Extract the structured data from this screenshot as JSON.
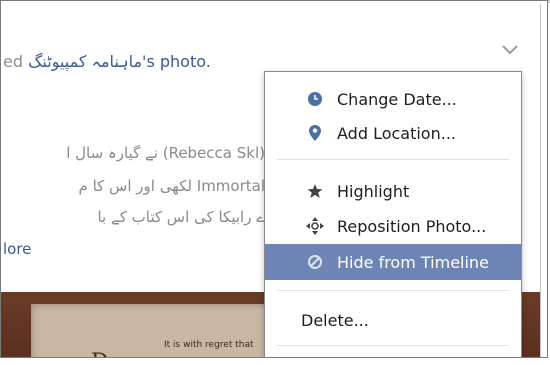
{
  "post": {
    "header_prefix": "ed ",
    "page_name": "ماہنامہ کمپیوٹنگ",
    "header_tail": "'s photo.",
    "body_lines": [
      "(Rebecca Skl) نے گیارہ سال ا",
      "Immortal لکھی اور اس کا م",
      "ے رابیکا کی اس کتاب کے با"
    ],
    "see_more": "lore"
  },
  "photo": {
    "initial": "D",
    "snippet": "It is with regret that"
  },
  "menu": {
    "items": [
      {
        "id": "change-date",
        "label": "Change Date...",
        "icon": "clock-icon"
      },
      {
        "id": "add-location",
        "label": "Add Location...",
        "icon": "map-pin-icon"
      },
      {
        "id": "highlight",
        "label": "Highlight",
        "icon": "star-icon"
      },
      {
        "id": "reposition-photo",
        "label": "Reposition Photo...",
        "icon": "move-arrows-icon"
      },
      {
        "id": "hide-from-timeline",
        "label": "Hide from Timeline",
        "icon": "hide-circle-icon"
      },
      {
        "id": "delete",
        "label": "Delete...",
        "icon": ""
      }
    ]
  },
  "colors": {
    "link": "#3b5998",
    "menu_active_bg": "#6d84b4",
    "menu_text": "#1d1d1d"
  }
}
